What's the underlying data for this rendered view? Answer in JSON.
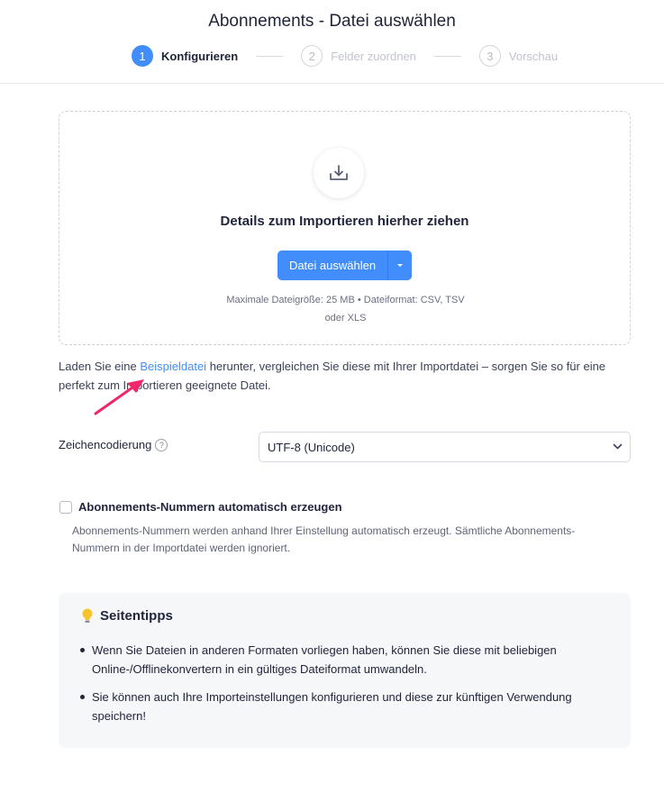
{
  "header": {
    "title": "Abonnements - Datei auswählen",
    "steps": [
      {
        "num": "1",
        "label": "Konfigurieren",
        "state": "active"
      },
      {
        "num": "2",
        "label": "Felder zuordnen",
        "state": "inactive"
      },
      {
        "num": "3",
        "label": "Vorschau",
        "state": "inactive"
      }
    ]
  },
  "dropzone": {
    "icon": "download-icon",
    "title": "Details zum Importieren hierher ziehen",
    "button_label": "Datei auswählen",
    "hint_line1": "Maximale Dateigröße: 25 MB •  Dateiformat: CSV, TSV",
    "hint_line2": "oder XLS"
  },
  "sample": {
    "before": "Laden Sie eine ",
    "link": "Beispieldatei",
    "after": " herunter, vergleichen Sie diese mit Ihrer Importdatei – sorgen Sie so für eine perfekt zum Importieren geeignete Datei."
  },
  "encoding": {
    "label": "Zeichencodierung",
    "help": "?",
    "value": "UTF-8 (Unicode)"
  },
  "autonumber": {
    "label": "Abonnements-Nummern automatisch erzeugen",
    "checked": false,
    "description": "Abonnements-Nummern werden anhand Ihrer Einstellung automatisch erzeugt. Sämtliche Abonnements-Nummern in der Importdatei werden ignoriert."
  },
  "tips": {
    "icon": "lightbulb-icon",
    "title": "Seitentipps",
    "items": [
      "Wenn Sie Dateien in anderen Formaten vorliegen haben, können Sie diese mit beliebigen Online-/Offlinekonvertern in ein gültiges Dateiformat umwandeln.",
      "Sie können auch Ihre Importeinstellungen konfigurieren und diese zur künftigen Verwendung speichern!"
    ]
  },
  "colors": {
    "accent": "#408dfb",
    "annotation_arrow": "#f0276b"
  }
}
